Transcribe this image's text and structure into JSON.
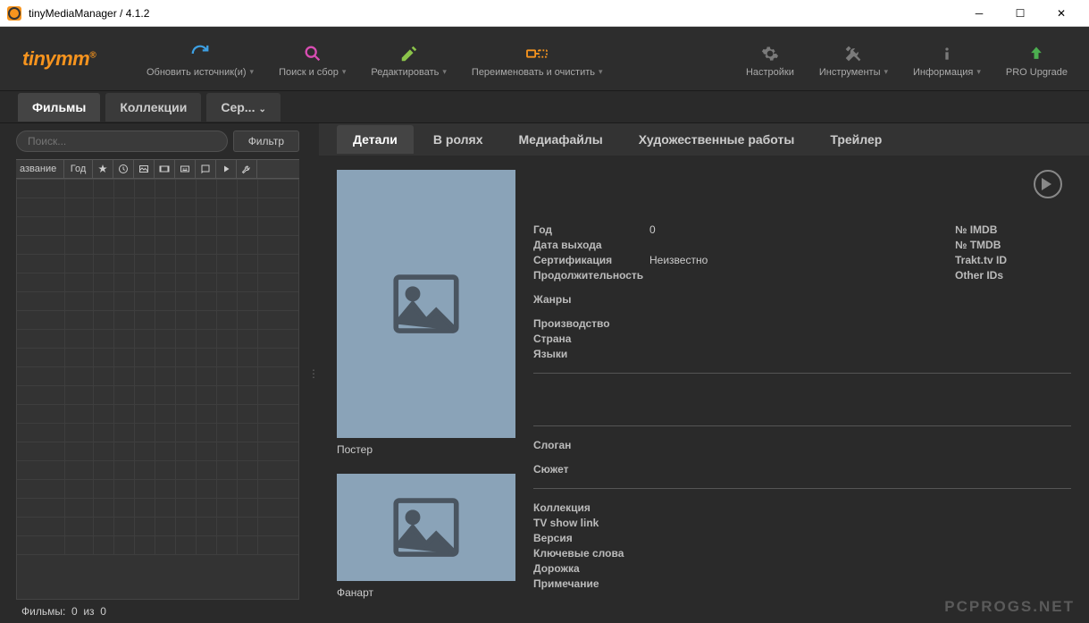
{
  "window": {
    "title": "tinyMediaManager / 4.1.2"
  },
  "logo": {
    "text": "tinymm",
    "reg": "®"
  },
  "toolbar": {
    "update": "Обновить источник(и)",
    "search": "Поиск и сбор",
    "edit": "Редактировать",
    "rename": "Переименовать и очистить",
    "settings": "Настройки",
    "tools": "Инструменты",
    "info": "Информация",
    "upgrade": "PRO Upgrade"
  },
  "modules": {
    "movies": "Фильмы",
    "sets": "Коллекции",
    "series": "Сер..."
  },
  "search": {
    "placeholder": "Поиск...",
    "filter": "Фильтр"
  },
  "columns": {
    "title": "азвание",
    "year": "Год"
  },
  "status": {
    "label": "Фильмы:",
    "count": "0",
    "of": "из",
    "total": "0"
  },
  "detailTabs": {
    "details": "Детали",
    "cast": "В ролях",
    "media": "Медиафайлы",
    "artwork": "Художественные работы",
    "trailer": "Трейлер"
  },
  "thumbs": {
    "poster": "Постер",
    "fanart": "Фанарт"
  },
  "details": {
    "yearLabel": "Год",
    "yearValue": "0",
    "releaseLabel": "Дата выхода",
    "certLabel": "Сертификация",
    "certValue": "Неизвестно",
    "runtimeLabel": "Продолжительность",
    "genresLabel": "Жанры",
    "studioLabel": "Производство",
    "countryLabel": "Страна",
    "langLabel": "Языки",
    "taglineLabel": "Слоган",
    "plotLabel": "Сюжет",
    "setLabel": "Коллекция",
    "showlinkLabel": "TV show link",
    "editionLabel": "Версия",
    "tagsLabel": "Ключевые слова",
    "pathLabel": "Дорожка",
    "noteLabel": "Примечание",
    "imdb": "№ IMDB",
    "tmdb": "№ TMDB",
    "trakt": "Trakt.tv ID",
    "other": "Other IDs"
  },
  "watermark": "PCPROGS.NET"
}
